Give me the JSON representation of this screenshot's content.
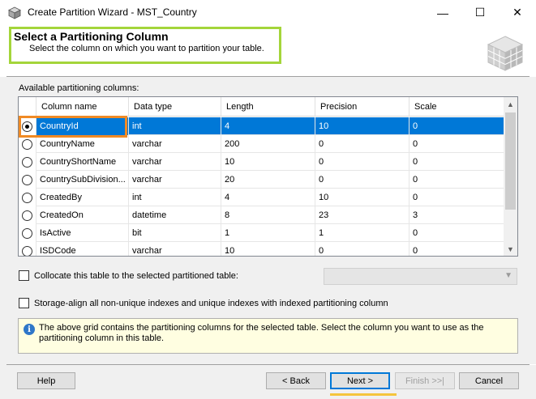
{
  "window": {
    "title": "Create Partition Wizard - MST_Country",
    "minimize": "—",
    "maximize": "☐",
    "close": "✕"
  },
  "header": {
    "title": "Select a Partitioning Column",
    "subtitle": "Select the column on which you want to partition your table."
  },
  "grid": {
    "label": "Available partitioning columns:",
    "columns": [
      "Column name",
      "Data type",
      "Length",
      "Precision",
      "Scale"
    ],
    "rows": [
      {
        "name": "CountryId",
        "type": "int",
        "length": "4",
        "precision": "10",
        "scale": "0",
        "selected": true
      },
      {
        "name": "CountryName",
        "type": "varchar",
        "length": "200",
        "precision": "0",
        "scale": "0"
      },
      {
        "name": "CountryShortName",
        "type": "varchar",
        "length": "10",
        "precision": "0",
        "scale": "0"
      },
      {
        "name": "CountrySubDivision...",
        "type": "varchar",
        "length": "20",
        "precision": "0",
        "scale": "0"
      },
      {
        "name": "CreatedBy",
        "type": "int",
        "length": "4",
        "precision": "10",
        "scale": "0"
      },
      {
        "name": "CreatedOn",
        "type": "datetime",
        "length": "8",
        "precision": "23",
        "scale": "3"
      },
      {
        "name": "IsActive",
        "type": "bit",
        "length": "1",
        "precision": "1",
        "scale": "0"
      },
      {
        "name": "ISDCode",
        "type": "varchar",
        "length": "10",
        "precision": "0",
        "scale": "0"
      }
    ]
  },
  "options": {
    "collocate_label": "Collocate this table to the selected partitioned table:",
    "storage_align_label": "Storage-align all non-unique indexes and unique indexes with indexed partitioning column"
  },
  "info": {
    "text": "The above grid contains the partitioning columns for the selected table. Select the column you want to use as the partitioning column in this table."
  },
  "buttons": {
    "help": "Help",
    "back": "< Back",
    "next": "Next >",
    "finish": "Finish >>|",
    "cancel": "Cancel"
  },
  "colors": {
    "selection": "#0078d7",
    "header_highlight": "#a4d53a",
    "cell_highlight": "#f08a24",
    "next_highlight": "#f5c43c",
    "info_bg": "#fffee1"
  }
}
